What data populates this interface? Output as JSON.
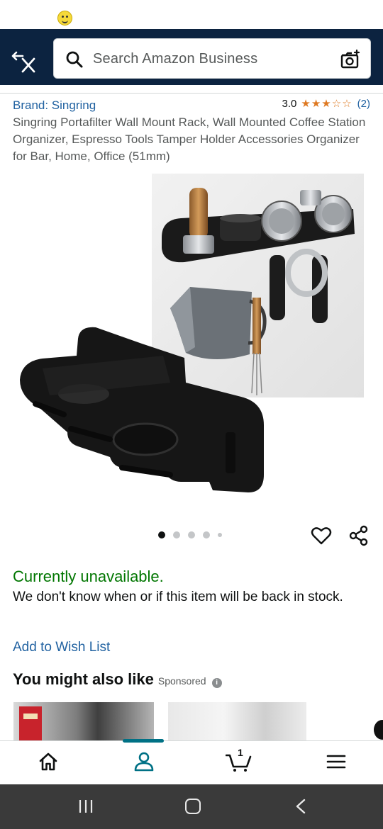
{
  "search": {
    "placeholder": "Search Amazon Business"
  },
  "product": {
    "brand": "Brand: Singring",
    "rating_value": "3.0",
    "rating_stars": 3,
    "rating_count": "(2)",
    "title": "Singring Portafilter Wall Mount Rack, Wall Mounted Coffee Station Organizer, Espresso Tools Tamper Holder Accessories Organizer for Bar, Home, Office (51mm)",
    "image_count": 5,
    "active_image": 1
  },
  "availability": {
    "status": "Currently unavailable.",
    "message": "We don't know when or if this item will be back in stock."
  },
  "actions": {
    "wishlist": "Add to Wish List"
  },
  "recommendations": {
    "title": "You might also like",
    "sponsored": "Sponsored"
  },
  "nav": {
    "cart_count": "1",
    "active": "account"
  },
  "icons": [
    "emoji-icon",
    "back-close-icon",
    "search-icon",
    "camera-icon",
    "heart-icon",
    "share-icon",
    "info-icon",
    "home-icon",
    "account-icon",
    "cart-icon",
    "menu-icon",
    "recent-apps-icon",
    "android-home-icon",
    "android-back-icon"
  ],
  "colors": {
    "header": "#0c2340",
    "link": "#2162a1",
    "star": "#de7921",
    "available_green": "#007600",
    "nav_indicator": "#007185"
  }
}
